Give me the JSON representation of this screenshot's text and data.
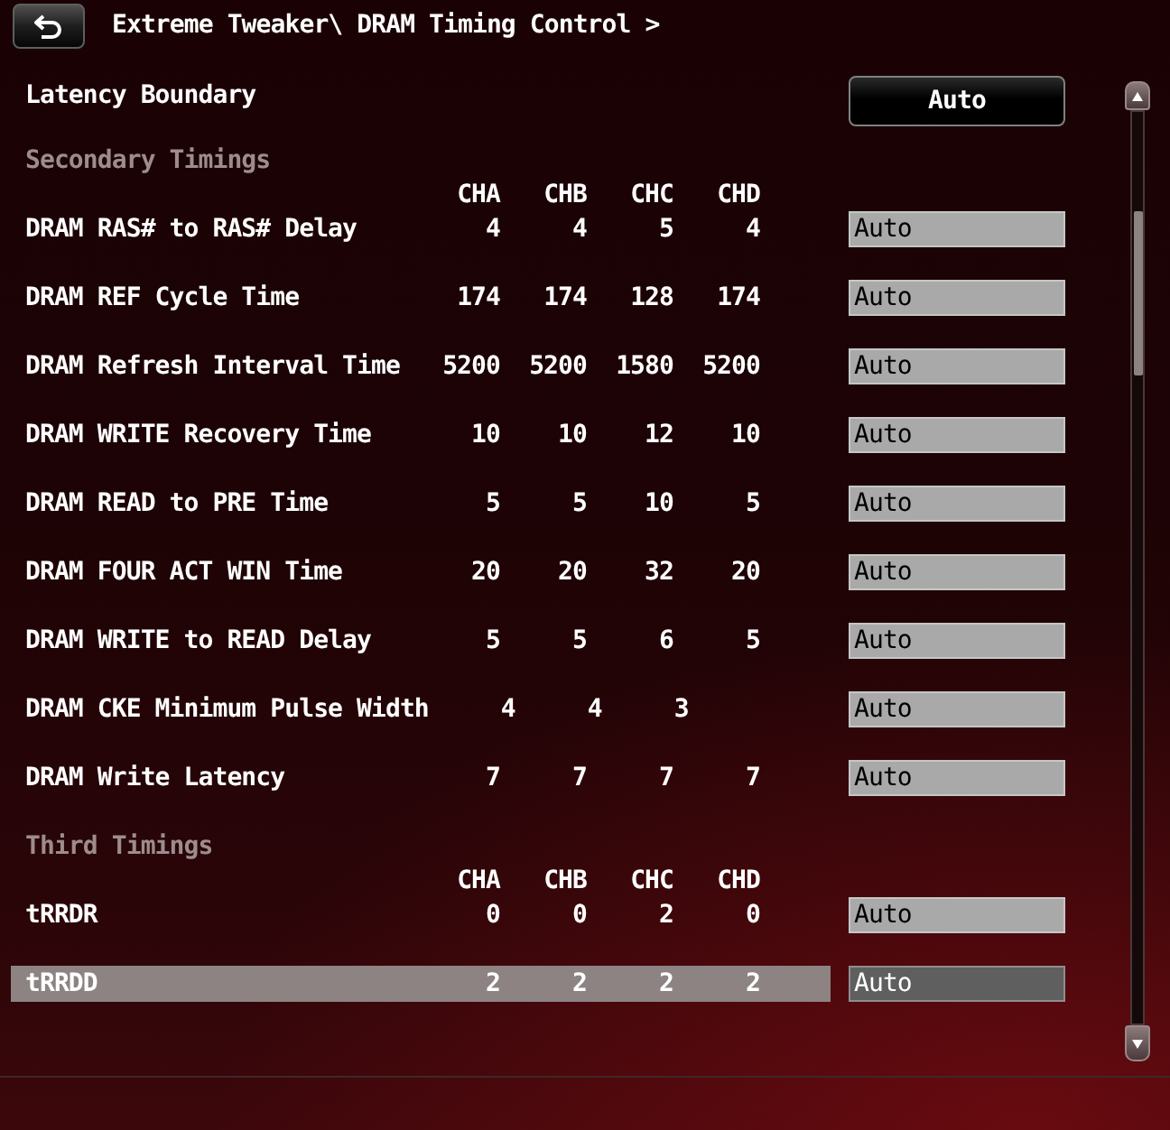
{
  "header": {
    "title": "Extreme Tweaker\\ DRAM Timing Control >"
  },
  "latency_boundary": {
    "label": "Latency Boundary",
    "value": "Auto"
  },
  "sections": [
    {
      "title": "Secondary Timings",
      "columns": [
        "CHA",
        "CHB",
        "CHC",
        "CHD"
      ],
      "rows": [
        {
          "label": "DRAM RAS# to RAS# Delay",
          "values": [
            "4",
            "4",
            "5",
            "4"
          ],
          "setting": "Auto",
          "selected": false
        },
        {
          "label": "DRAM REF Cycle Time",
          "values": [
            "174",
            "174",
            "128",
            "174"
          ],
          "setting": "Auto",
          "selected": false
        },
        {
          "label": "DRAM Refresh Interval Time",
          "values": [
            "5200",
            "5200",
            "1580",
            "5200"
          ],
          "setting": "Auto",
          "selected": false
        },
        {
          "label": "DRAM WRITE Recovery Time",
          "values": [
            "10",
            "10",
            "12",
            "10"
          ],
          "setting": "Auto",
          "selected": false
        },
        {
          "label": "DRAM READ to PRE Time",
          "values": [
            "5",
            "5",
            "10",
            "5"
          ],
          "setting": "Auto",
          "selected": false
        },
        {
          "label": "DRAM FOUR ACT WIN Time",
          "values": [
            "20",
            "20",
            "32",
            "20"
          ],
          "setting": "Auto",
          "selected": false
        },
        {
          "label": "DRAM WRITE to READ Delay",
          "values": [
            "5",
            "5",
            "6",
            "5"
          ],
          "setting": "Auto",
          "selected": false
        },
        {
          "label": "DRAM CKE Minimum Pulse Width",
          "values": [
            "4",
            "4",
            "3"
          ],
          "setting": "Auto",
          "selected": false
        },
        {
          "label": "DRAM Write Latency",
          "values": [
            "7",
            "7",
            "7",
            "7"
          ],
          "setting": "Auto",
          "selected": false
        }
      ]
    },
    {
      "title": "Third Timings",
      "columns": [
        "CHA",
        "CHB",
        "CHC",
        "CHD"
      ],
      "rows": [
        {
          "label": "tRRDR",
          "values": [
            "0",
            "0",
            "2",
            "0"
          ],
          "setting": "Auto",
          "selected": false
        },
        {
          "label": "tRRDD",
          "values": [
            "2",
            "2",
            "2",
            "2"
          ],
          "setting": "Auto",
          "selected": true
        }
      ]
    }
  ]
}
